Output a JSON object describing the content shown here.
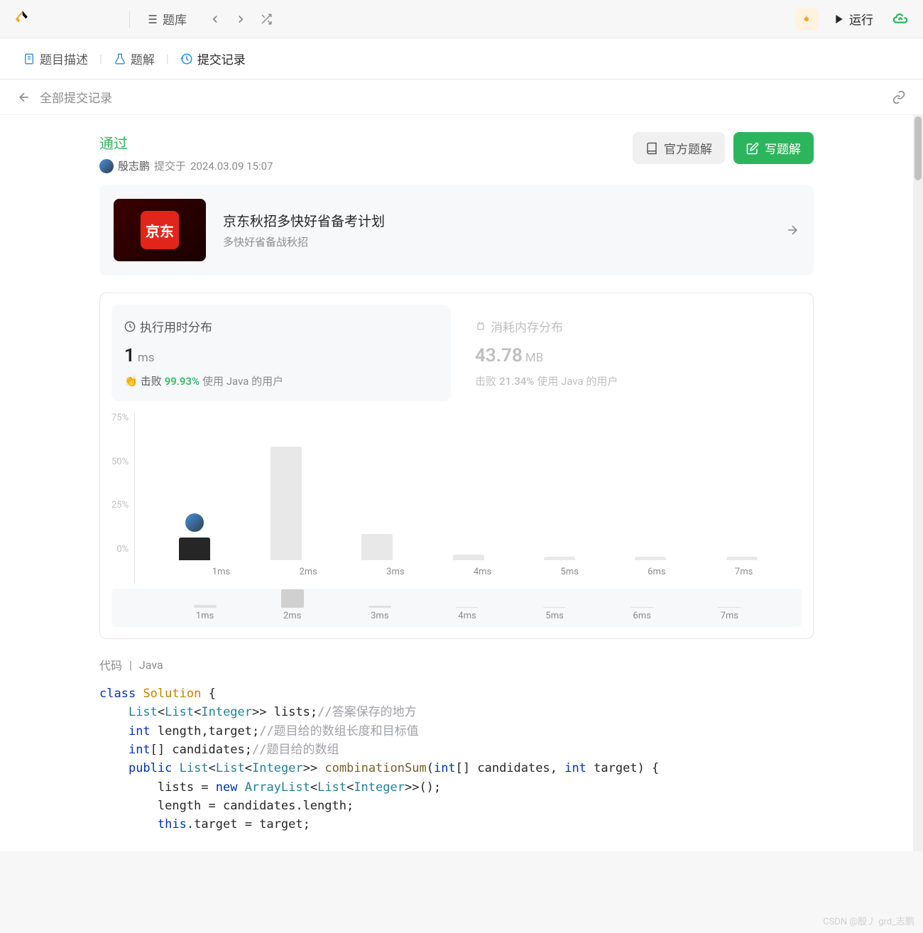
{
  "toolbar": {
    "problems_label": "题库",
    "run_label": "运行"
  },
  "tabs": {
    "description": "题目描述",
    "solution": "题解",
    "submissions": "提交记录"
  },
  "breadcrumb": {
    "back_label": "全部提交记录"
  },
  "status": {
    "result": "通过",
    "username": "殷志鹏",
    "submitted_prefix": "提交于",
    "submitted_time": "2024.03.09 15:07"
  },
  "buttons": {
    "official_solution": "官方题解",
    "write_solution": "写题解"
  },
  "promo": {
    "logo_text": "京东",
    "title": "京东秋招多快好省备考计划",
    "subtitle": "多快好省备战秋招"
  },
  "stats": {
    "runtime": {
      "title": "执行用时分布",
      "value": "1",
      "unit": "ms",
      "beat_label": "击败",
      "beat_pct": "99.93%",
      "lang_text": "使用 Java 的用户"
    },
    "memory": {
      "title": "消耗内存分布",
      "value": "43.78",
      "unit": "MB",
      "beat_label": "击败",
      "beat_pct": "21.34%",
      "lang_text": "使用 Java 的用户"
    }
  },
  "chart_data": {
    "type": "bar",
    "categories": [
      "1ms",
      "2ms",
      "3ms",
      "4ms",
      "5ms",
      "6ms",
      "7ms"
    ],
    "values": [
      12,
      60,
      14,
      3,
      2,
      2,
      2
    ],
    "current_index": 0,
    "xlabel": "",
    "ylabel": "",
    "ylim": [
      0,
      75
    ],
    "y_ticks": [
      "75%",
      "50%",
      "25%",
      "0%"
    ],
    "title": "执行用时分布"
  },
  "mini_chart": {
    "categories": [
      "1ms",
      "2ms",
      "3ms",
      "4ms",
      "5ms",
      "6ms",
      "7ms"
    ],
    "values": [
      3,
      20,
      2,
      1,
      1,
      1,
      1
    ],
    "selected_index": 1
  },
  "code": {
    "header_label": "代码",
    "language": "Java",
    "lines": [
      {
        "t": "class",
        "c": "kw"
      },
      {
        "t": " "
      },
      {
        "t": "Solution",
        "c": "cls"
      },
      {
        "t": " {"
      },
      {
        "br": true
      },
      {
        "t": "    "
      },
      {
        "t": "List",
        "c": "type"
      },
      {
        "t": "<"
      },
      {
        "t": "List",
        "c": "type"
      },
      {
        "t": "<"
      },
      {
        "t": "Integer",
        "c": "type"
      },
      {
        "t": ">> "
      },
      {
        "t": "lists",
        "c": ""
      },
      {
        "t": ";"
      },
      {
        "t": "//答案保存的地方",
        "c": "comment"
      },
      {
        "br": true
      },
      {
        "t": "    "
      },
      {
        "t": "int",
        "c": "kw"
      },
      {
        "t": " length,target;"
      },
      {
        "t": "//题目给的数组长度和目标值",
        "c": "comment"
      },
      {
        "br": true
      },
      {
        "t": "    "
      },
      {
        "t": "int",
        "c": "kw"
      },
      {
        "t": "[] candidates;"
      },
      {
        "t": "//题目给的数组",
        "c": "comment"
      },
      {
        "br": true
      },
      {
        "t": "    "
      },
      {
        "t": "public",
        "c": "kw"
      },
      {
        "t": " "
      },
      {
        "t": "List",
        "c": "type"
      },
      {
        "t": "<"
      },
      {
        "t": "List",
        "c": "type"
      },
      {
        "t": "<"
      },
      {
        "t": "Integer",
        "c": "type"
      },
      {
        "t": ">> "
      },
      {
        "t": "combinationSum",
        "c": "method"
      },
      {
        "t": "("
      },
      {
        "t": "int",
        "c": "kw"
      },
      {
        "t": "[] candidates, "
      },
      {
        "t": "int",
        "c": "kw"
      },
      {
        "t": " target) {"
      },
      {
        "br": true
      },
      {
        "t": "        lists = "
      },
      {
        "t": "new",
        "c": "kw"
      },
      {
        "t": " "
      },
      {
        "t": "ArrayList",
        "c": "type"
      },
      {
        "t": "<"
      },
      {
        "t": "List",
        "c": "type"
      },
      {
        "t": "<"
      },
      {
        "t": "Integer",
        "c": "type"
      },
      {
        "t": ">>();"
      },
      {
        "br": true
      },
      {
        "t": "        length = candidates.length;"
      },
      {
        "br": true
      },
      {
        "t": "        "
      },
      {
        "t": "this",
        "c": "kw"
      },
      {
        "t": ".target = target;"
      },
      {
        "br": true
      }
    ]
  },
  "watermark": "CSDN @殷丿 grd_志鹏"
}
